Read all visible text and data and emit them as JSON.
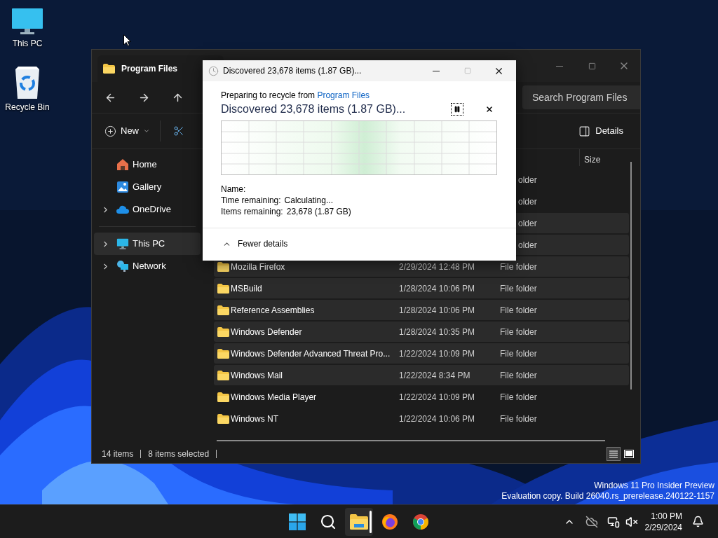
{
  "desktop": {
    "icons": [
      {
        "label": "This PC",
        "kind": "pc"
      },
      {
        "label": "Recycle Bin",
        "kind": "bin"
      }
    ],
    "watermark": [
      "Windows 11 Pro Insider Preview",
      "Evaluation copy. Build 26040.rs_prerelease.240122-1157"
    ]
  },
  "explorer": {
    "tab_title": "Program Files",
    "search": {
      "placeholder": "Search Program Files"
    },
    "toolbar": {
      "new": "New",
      "details": "Details"
    },
    "sidebar_groups": [
      {
        "items": [
          {
            "label": "Home",
            "kind": "home",
            "expandable": false,
            "selected": false
          },
          {
            "label": "Gallery",
            "kind": "gallery",
            "expandable": false,
            "selected": false
          },
          {
            "label": "OneDrive",
            "kind": "cloud",
            "expandable": true,
            "selected": false
          }
        ]
      },
      {
        "items": [
          {
            "label": "This PC",
            "kind": "pc",
            "expandable": true,
            "selected": true
          },
          {
            "label": "Network",
            "kind": "network",
            "expandable": true,
            "selected": false
          }
        ]
      }
    ],
    "column_header": "Size",
    "rows": [
      {
        "type": "older",
        "selected": false
      },
      {
        "type": "older",
        "selected": false
      },
      {
        "type": "older",
        "selected": true
      },
      {
        "type": "older",
        "selected": true
      },
      {
        "name": "Mozilla Firefox",
        "modified": "2/29/2024 12:48 PM",
        "type": "File folder",
        "selected": true
      },
      {
        "name": "MSBuild",
        "modified": "1/28/2024 10:06 PM",
        "type": "File folder",
        "selected": true
      },
      {
        "name": "Reference Assemblies",
        "modified": "1/28/2024 10:06 PM",
        "type": "File folder",
        "selected": true
      },
      {
        "name": "Windows Defender",
        "modified": "1/28/2024 10:35 PM",
        "type": "File folder",
        "selected": true
      },
      {
        "name": "Windows Defender Advanced Threat Pro...",
        "modified": "1/22/2024 10:09 PM",
        "type": "File folder",
        "selected": true
      },
      {
        "name": "Windows Mail",
        "modified": "1/22/2024 8:34 PM",
        "type": "File folder",
        "selected": true
      },
      {
        "name": "Windows Media Player",
        "modified": "1/22/2024 10:09 PM",
        "type": "File folder",
        "selected": false
      },
      {
        "name": "Windows NT",
        "modified": "1/22/2024 10:06 PM",
        "type": "File folder",
        "selected": false
      }
    ],
    "status": {
      "count": "14 items",
      "selection": "8 items selected"
    }
  },
  "dialog": {
    "title": "Discovered 23,678 items (1.87 GB)...",
    "prefix": "Preparing to recycle from",
    "link": "Program Files",
    "heading": "Discovered 23,678 items (1.87 GB)...",
    "details": [
      {
        "label": "Name:"
      },
      {
        "label": "Time remaining:",
        "value": "Calculating..."
      },
      {
        "label": "Items remaining:",
        "value": "23,678 (1.87 GB)"
      }
    ],
    "toggle": "Fewer details"
  },
  "taskbar": {
    "apps": [
      {
        "kind": "start",
        "active": false
      },
      {
        "kind": "search",
        "active": false
      },
      {
        "kind": "explorer",
        "active": true
      },
      {
        "kind": "firefox",
        "active": false
      },
      {
        "kind": "chrome",
        "active": false
      }
    ],
    "clock": {
      "time": "1:00 PM",
      "date": "2/29/2024"
    }
  }
}
